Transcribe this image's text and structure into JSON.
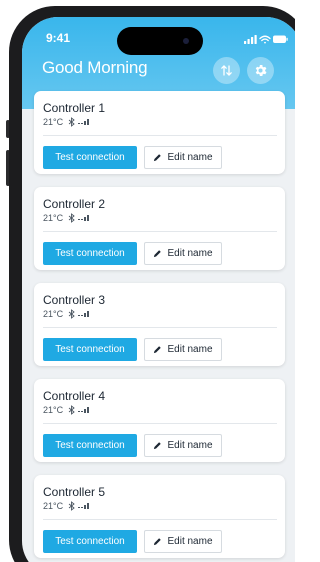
{
  "status_bar": {
    "time": "9:41"
  },
  "header": {
    "title": "Good Morning",
    "sort_icon": "sort-arrows-icon",
    "settings_icon": "gear-icon"
  },
  "controllers": [
    {
      "name": "Controller 1",
      "temperature": "21°C"
    },
    {
      "name": "Controller 2",
      "temperature": "21°C"
    },
    {
      "name": "Controller 3",
      "temperature": "21°C"
    },
    {
      "name": "Controller 4",
      "temperature": "21°C"
    },
    {
      "name": "Controller 5",
      "temperature": "21°C"
    }
  ],
  "actions": {
    "test_label": "Test connection",
    "edit_label": "Edit name"
  },
  "colors": {
    "header": "#39b6ec",
    "primary_button": "#1fa9e3",
    "background": "#eef1f4"
  }
}
